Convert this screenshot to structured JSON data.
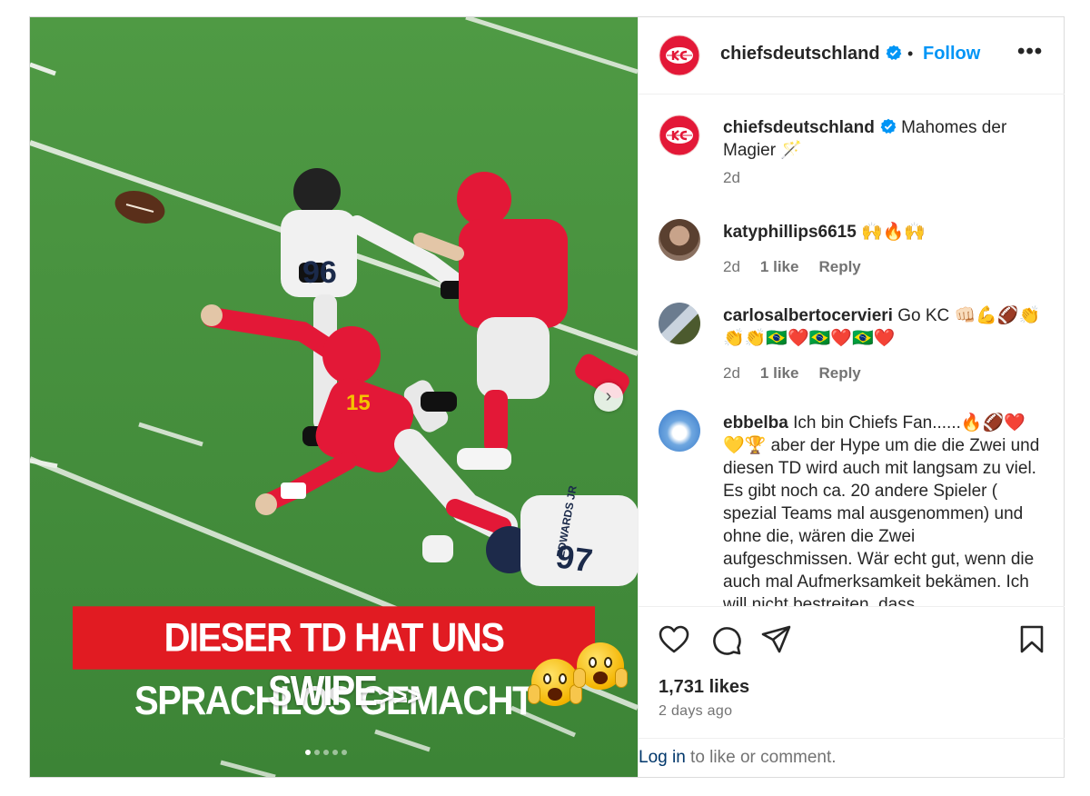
{
  "media": {
    "banner_text": "DIESER TD HAT UNS SPRACHLOS GEMACHT",
    "swipe_text": "SWIPE",
    "swipe_arrows": ">>>",
    "jersey_front": "15",
    "jersey_back_left": "96",
    "jersey_back_right": "97",
    "jersey_back_name": "EDWARDS JR",
    "carousel_dots": 5,
    "active_dot": 0,
    "next_icon": "chevron-right-icon"
  },
  "header": {
    "username": "chiefsdeutschland",
    "separator": "•",
    "follow_label": "Follow",
    "more_label": "•••"
  },
  "comments": [
    {
      "username": "chiefsdeutschland",
      "text": "Mahomes der Magier 🪄",
      "age": "2d",
      "verified": true
    },
    {
      "username": "katyphillips6615",
      "text": "🙌🔥🙌",
      "age": "2d",
      "likes": "1 like",
      "reply": "Reply"
    },
    {
      "username": "carlosalbertocervieri",
      "text": "Go KC 👊🏻💪🏈👏👏👏🇧🇷❤️🇧🇷❤️🇧🇷❤️",
      "age": "2d",
      "likes": "1 like",
      "reply": "Reply"
    },
    {
      "username": "ebbelba",
      "text": "Ich bin Chiefs Fan......🔥🏈❤️💛🏆 aber der Hype um die die Zwei und diesen TD wird auch mit langsam zu viel. Es gibt noch ca. 20 andere Spieler ( spezial Teams mal ausgenommen) und ohne die, wären die Zwei aufgeschmissen. Wär echt gut, wenn die auch mal Aufmerksamkeit bekämen. Ich will nicht bestreiten, dass"
    }
  ],
  "actions": {
    "like_icon": "heart-icon",
    "comment_icon": "comment-icon",
    "share_icon": "share-icon",
    "save_icon": "bookmark-icon",
    "likes_count": "1,731 likes",
    "posted": "2 days ago"
  },
  "login": {
    "link_label": "Log in",
    "rest_text": " to like or comment."
  },
  "colors": {
    "link_blue": "#0095f6",
    "chiefs_red": "#e31837",
    "banner_red": "#e11b22",
    "verified_blue": "#0095f6"
  }
}
